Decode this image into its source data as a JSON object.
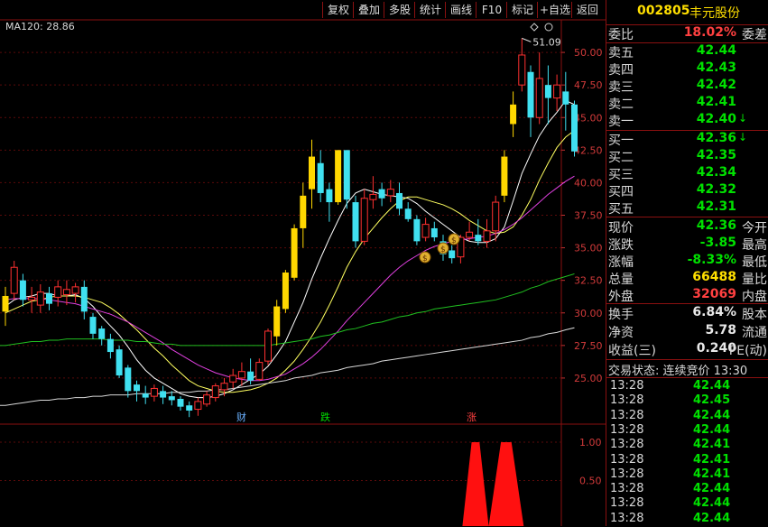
{
  "toolbar": {
    "buttons": [
      "复权",
      "叠加",
      "多股",
      "统计",
      "画线",
      "F10",
      "标记",
      "+自选",
      "返回"
    ]
  },
  "chart": {
    "ma_label": "MA120: 28.86",
    "high_label": "51.09",
    "y_ticks": [
      "50.00",
      "47.50",
      "45.00",
      "42.50",
      "40.00",
      "37.50",
      "35.00",
      "32.50",
      "30.00",
      "27.50",
      "25.00"
    ],
    "sub_ticks": [
      "1.00",
      "0.50"
    ],
    "events": [
      {
        "text": "财",
        "color": "#6ab0ff"
      },
      {
        "text": "跌",
        "color": "#00e000"
      },
      {
        "text": "涨",
        "color": "#ff4040"
      }
    ],
    "colors": {
      "up": "#ff3030",
      "down": "#40e0f0",
      "flat_yellow": "#ffd700",
      "ma5": "#ffffff",
      "ma10": "#ffff60",
      "ma20": "#e040e0",
      "ma60": "#20c020",
      "ma120": "#d8d8d8",
      "grid": "#5a0a0a"
    }
  },
  "chart_data": {
    "type": "candlestick",
    "ylim": [
      22.5,
      52.5
    ],
    "high_marker": 51.09,
    "candles": [
      [
        30.1,
        31.3,
        29.0,
        32.0
      ],
      [
        31.5,
        33.5,
        31.0,
        34.0
      ],
      [
        32.5,
        31.0,
        30.5,
        33.0
      ],
      [
        31.0,
        31.2,
        30.0,
        32.0
      ],
      [
        30.6,
        31.6,
        30.0,
        32.2
      ],
      [
        31.5,
        30.7,
        30.2,
        32.0
      ],
      [
        31.2,
        32.0,
        30.5,
        32.5
      ],
      [
        31.4,
        31.8,
        30.6,
        32.5
      ],
      [
        31.5,
        32.0,
        30.8,
        32.3
      ],
      [
        32.0,
        30.1,
        29.5,
        32.5
      ],
      [
        29.7,
        28.4,
        28.0,
        30.0
      ],
      [
        28.8,
        28.0,
        27.5,
        29.0
      ],
      [
        28.0,
        27.0,
        26.5,
        28.4
      ],
      [
        27.2,
        25.2,
        25.0,
        27.5
      ],
      [
        25.8,
        24.0,
        23.5,
        26.0
      ],
      [
        24.5,
        24.0,
        23.2,
        24.8
      ],
      [
        23.8,
        23.5,
        23.0,
        24.4
      ],
      [
        23.6,
        24.2,
        23.2,
        24.5
      ],
      [
        24.0,
        23.5,
        23.0,
        24.4
      ],
      [
        23.6,
        23.3,
        22.9,
        24.0
      ],
      [
        23.4,
        22.8,
        22.5,
        23.6
      ],
      [
        22.9,
        22.5,
        22.0,
        23.2
      ],
      [
        22.6,
        23.2,
        22.1,
        23.5
      ],
      [
        23.0,
        23.7,
        22.8,
        24.0
      ],
      [
        23.5,
        24.4,
        23.2,
        24.6
      ],
      [
        24.1,
        24.6,
        23.6,
        25.0
      ],
      [
        24.7,
        25.2,
        24.2,
        25.7
      ],
      [
        25.0,
        25.5,
        24.4,
        26.2
      ],
      [
        25.5,
        24.8,
        24.5,
        26.5
      ],
      [
        24.9,
        26.2,
        24.8,
        26.5
      ],
      [
        26.3,
        28.6,
        26.0,
        28.8
      ],
      [
        28.2,
        30.5,
        27.5,
        31.0
      ],
      [
        30.3,
        33.1,
        30.0,
        33.3
      ],
      [
        32.7,
        36.5,
        32.5,
        36.8
      ],
      [
        36.5,
        39.0,
        35.0,
        40.0
      ],
      [
        39.5,
        42.0,
        38.0,
        43.3
      ],
      [
        41.5,
        39.2,
        38.5,
        42.5
      ],
      [
        39.5,
        38.5,
        37.0,
        40.0
      ],
      [
        38.5,
        42.5,
        38.3,
        42.5
      ],
      [
        42.5,
        38.7,
        38.0,
        42.5
      ],
      [
        38.5,
        35.5,
        35.0,
        39.0
      ],
      [
        35.5,
        38.8,
        35.2,
        39.5
      ],
      [
        38.7,
        39.1,
        38.0,
        40.5
      ],
      [
        39.5,
        38.8,
        38.2,
        40.0
      ],
      [
        39.0,
        39.5,
        38.5,
        40.2
      ],
      [
        39.2,
        38.0,
        37.5,
        40.0
      ],
      [
        38.0,
        37.2,
        37.0,
        38.5
      ],
      [
        37.2,
        35.5,
        35.2,
        37.5
      ],
      [
        35.8,
        36.8,
        35.5,
        37.3
      ],
      [
        36.5,
        35.8,
        35.5,
        37.0
      ],
      [
        35.5,
        34.5,
        34.0,
        36.0
      ],
      [
        34.8,
        34.2,
        33.8,
        35.2
      ],
      [
        34.3,
        35.8,
        33.8,
        36.0
      ],
      [
        35.8,
        36.2,
        35.5,
        37.0
      ],
      [
        36.0,
        35.5,
        35.2,
        37.2
      ],
      [
        35.5,
        36.3,
        35.0,
        37.2
      ],
      [
        36.3,
        38.5,
        35.5,
        39.0
      ],
      [
        39.0,
        42.0,
        38.5,
        42.5
      ],
      [
        44.5,
        46.0,
        43.5,
        47.0
      ],
      [
        47.5,
        49.8,
        47.0,
        51.09
      ],
      [
        48.5,
        45.0,
        43.5,
        49.0
      ],
      [
        45.0,
        48.0,
        44.5,
        50.0
      ],
      [
        47.5,
        46.5,
        44.5,
        49.0
      ],
      [
        46.5,
        47.5,
        45.5,
        48.3
      ],
      [
        47.0,
        46.0,
        44.0,
        48.5
      ],
      [
        46.0,
        42.4,
        42.0,
        46.3
      ]
    ],
    "ma": [
      {
        "name": "MA5",
        "values": [
          30.5,
          31.0,
          31.2,
          31.3,
          31.5,
          31.5,
          31.3,
          31.3,
          31.4,
          31.1,
          30.5,
          29.7,
          29.0,
          28.3,
          27.4,
          26.4,
          25.6,
          25.0,
          24.6,
          24.2,
          23.8,
          23.6,
          23.5,
          23.5,
          23.6,
          23.8,
          24.1,
          24.5,
          24.9,
          25.3,
          25.9,
          26.8,
          27.8,
          29.3,
          30.8,
          32.6,
          34.2,
          35.7,
          37.1,
          38.4,
          39.2,
          39.5,
          39.3,
          39.1,
          39.0,
          38.9,
          38.8,
          38.4,
          37.8,
          37.3,
          36.8,
          36.3,
          35.8,
          35.5,
          35.4,
          35.4,
          35.7,
          36.6,
          38.6,
          40.7,
          42.2,
          43.6,
          44.6,
          45.4,
          46.3,
          46.0
        ]
      },
      {
        "name": "MA10",
        "values": [
          30.0,
          30.3,
          30.6,
          30.9,
          31.0,
          31.2,
          31.3,
          31.3,
          31.3,
          31.2,
          31.0,
          30.8,
          30.4,
          29.9,
          29.3,
          28.7,
          28.0,
          27.3,
          26.7,
          26.0,
          25.4,
          24.8,
          24.4,
          24.2,
          24.0,
          23.9,
          23.9,
          24.0,
          24.1,
          24.3,
          24.6,
          25.0,
          25.6,
          26.3,
          27.2,
          28.2,
          29.3,
          30.6,
          32.0,
          33.5,
          34.7,
          35.7,
          36.5,
          37.3,
          38.0,
          38.6,
          38.9,
          38.9,
          38.7,
          38.5,
          38.3,
          38.0,
          37.6,
          37.1,
          36.7,
          36.3,
          36.1,
          36.2,
          36.6,
          37.5,
          38.7,
          40.2,
          41.5,
          42.7,
          43.5,
          44.0
        ]
      },
      {
        "name": "MA20",
        "values": [
          31.0,
          31.1,
          31.1,
          31.1,
          31.1,
          31.0,
          30.9,
          30.8,
          30.7,
          30.5,
          30.3,
          30.1,
          29.9,
          29.6,
          29.3,
          28.9,
          28.5,
          28.1,
          27.7,
          27.2,
          26.8,
          26.4,
          26.0,
          25.7,
          25.4,
          25.2,
          25.0,
          24.9,
          24.8,
          24.8,
          24.9,
          25.1,
          25.3,
          25.7,
          26.1,
          26.6,
          27.2,
          27.9,
          28.6,
          29.4,
          30.1,
          30.8,
          31.5,
          32.2,
          32.9,
          33.5,
          34.0,
          34.4,
          34.8,
          35.1,
          35.3,
          35.5,
          35.6,
          35.7,
          35.8,
          35.9,
          36.1,
          36.4,
          36.8,
          37.3,
          37.9,
          38.5,
          39.1,
          39.6,
          40.1,
          40.5
        ]
      },
      {
        "name": "MA60",
        "values": [
          27.5,
          27.6,
          27.7,
          27.8,
          27.8,
          27.9,
          27.9,
          28.0,
          28.0,
          28.0,
          28.0,
          28.0,
          27.9,
          27.9,
          27.9,
          27.8,
          27.8,
          27.7,
          27.6,
          27.6,
          27.5,
          27.5,
          27.5,
          27.5,
          27.5,
          27.5,
          27.5,
          27.5,
          27.5,
          27.5,
          27.5,
          27.6,
          27.7,
          27.8,
          27.9,
          28.0,
          28.2,
          28.3,
          28.5,
          28.7,
          28.8,
          29.0,
          29.2,
          29.3,
          29.5,
          29.7,
          29.8,
          30.0,
          30.1,
          30.3,
          30.4,
          30.5,
          30.6,
          30.7,
          30.8,
          30.9,
          31.0,
          31.2,
          31.4,
          31.6,
          31.9,
          32.1,
          32.4,
          32.6,
          32.8,
          33.0
        ]
      },
      {
        "name": "MA120",
        "values": [
          22.9,
          23.0,
          23.1,
          23.2,
          23.3,
          23.3,
          23.4,
          23.4,
          23.5,
          23.5,
          23.6,
          23.6,
          23.7,
          23.7,
          23.7,
          23.8,
          23.8,
          23.8,
          23.8,
          23.9,
          23.9,
          23.9,
          24.0,
          24.0,
          24.1,
          24.1,
          24.2,
          24.3,
          24.4,
          24.5,
          24.6,
          24.7,
          24.8,
          25.0,
          25.1,
          25.2,
          25.4,
          25.5,
          25.6,
          25.8,
          25.9,
          26.0,
          26.1,
          26.3,
          26.4,
          26.5,
          26.6,
          26.7,
          26.8,
          26.9,
          27.0,
          27.1,
          27.2,
          27.3,
          27.4,
          27.5,
          27.6,
          27.7,
          27.8,
          27.9,
          28.1,
          28.2,
          28.4,
          28.5,
          28.7,
          28.86
        ]
      }
    ],
    "sub_indicator": {
      "ylim": [
        0,
        1.2
      ],
      "peaks": [
        {
          "from": 52,
          "to": 55,
          "value": 1.0
        },
        {
          "from": 55,
          "to": 59,
          "value": 1.0
        }
      ]
    }
  },
  "panel": {
    "code": "002805",
    "name": "丰元股份",
    "weibi": {
      "label": "委比",
      "value": "18.02%",
      "right": "委差"
    },
    "asks": [
      {
        "label": "卖五",
        "price": "42.44"
      },
      {
        "label": "卖四",
        "price": "42.43"
      },
      {
        "label": "卖三",
        "price": "42.42"
      },
      {
        "label": "卖二",
        "price": "42.41"
      },
      {
        "label": "卖一",
        "price": "42.40",
        "arrow": "↓"
      }
    ],
    "bids": [
      {
        "label": "买一",
        "price": "42.36",
        "arrow": "↓"
      },
      {
        "label": "买二",
        "price": "42.35"
      },
      {
        "label": "买三",
        "price": "42.34"
      },
      {
        "label": "买四",
        "price": "42.32"
      },
      {
        "label": "买五",
        "price": "42.31"
      }
    ],
    "stats": [
      {
        "label": "现价",
        "value": "42.36",
        "right": "今开",
        "color": "green"
      },
      {
        "label": "涨跌",
        "value": "-3.85",
        "right": "最高",
        "color": "green"
      },
      {
        "label": "涨幅",
        "value": "-8.33%",
        "right": "最低",
        "color": "green"
      },
      {
        "label": "总量",
        "value": "66488",
        "right": "量比",
        "color": "yellow"
      },
      {
        "label": "外盘",
        "value": "32069",
        "right": "内盘",
        "color": "red"
      }
    ],
    "stats2": [
      {
        "label": "换手",
        "value": "6.84%",
        "right": "股本",
        "color": "white"
      },
      {
        "label": "净资",
        "value": "5.78",
        "right": "流通",
        "color": "white"
      },
      {
        "label": "收益(三)",
        "value": "0.240",
        "right": "PE(动)",
        "color": "white"
      }
    ],
    "trade_status": "交易状态: 连续竞价 13:30",
    "ticks": [
      {
        "time": "13:28",
        "price": "42.44"
      },
      {
        "time": "13:28",
        "price": "42.45"
      },
      {
        "time": "13:28",
        "price": "42.44"
      },
      {
        "time": "13:28",
        "price": "42.44"
      },
      {
        "time": "13:28",
        "price": "42.41"
      },
      {
        "time": "13:28",
        "price": "42.41"
      },
      {
        "time": "13:28",
        "price": "42.41"
      },
      {
        "time": "13:28",
        "price": "42.44"
      },
      {
        "time": "13:28",
        "price": "42.44"
      },
      {
        "time": "13:28",
        "price": "42.44"
      }
    ]
  }
}
